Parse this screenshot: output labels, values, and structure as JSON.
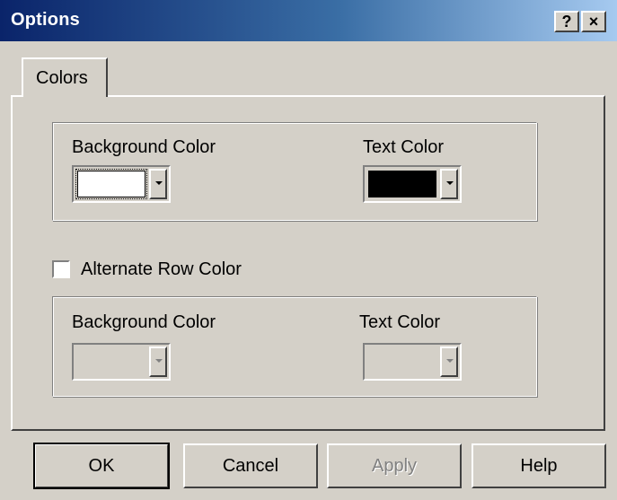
{
  "window": {
    "title": "Options"
  },
  "titlebar_buttons": {
    "help": "?",
    "close": "×"
  },
  "tabs": [
    {
      "label": "Colors",
      "active": true
    }
  ],
  "primary_colors": {
    "background_label": "Background Color",
    "text_label": "Text Color",
    "background_value": "#ffffff",
    "text_value": "#000000"
  },
  "alternate_row": {
    "checkbox_label": "Alternate Row Color",
    "checked": false,
    "background_label": "Background Color",
    "text_label": "Text Color",
    "enabled": false
  },
  "buttons": {
    "ok": "OK",
    "cancel": "Cancel",
    "apply": "Apply",
    "help": "Help"
  },
  "colors": {
    "title_start": "#0a246a",
    "title_end": "#a6caf0",
    "face": "#d4d0c8",
    "disabled_text": "#808080"
  }
}
